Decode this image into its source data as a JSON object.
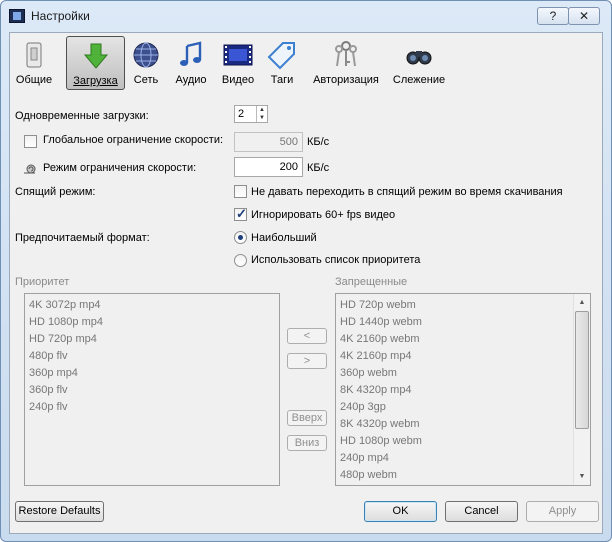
{
  "window": {
    "title": "Настройки",
    "help_label": "?",
    "close_label": "✕"
  },
  "toolbar": {
    "tabs": [
      {
        "label": "Общие",
        "icon": "switch-icon"
      },
      {
        "label": "Загрузка",
        "icon": "download-arrow-icon"
      },
      {
        "label": "Сеть",
        "icon": "globe-icon"
      },
      {
        "label": "Аудио",
        "icon": "music-note-icon"
      },
      {
        "label": "Видео",
        "icon": "film-strip-icon"
      },
      {
        "label": "Таги",
        "icon": "tag-icon"
      },
      {
        "label": "Авторизация",
        "icon": "keys-icon"
      },
      {
        "label": "Слежение",
        "icon": "binoculars-icon"
      }
    ],
    "active": "Загрузка"
  },
  "form": {
    "concurrent_label": "Одновременные загрузки:",
    "concurrent_value": "2",
    "global_limit_label": "Глобальное ограничение скорости:",
    "global_limit_value": "500",
    "global_limit_unit": "КБ/с",
    "global_limit_checked": false,
    "limit_mode_label": "Режим ограничения скорости:",
    "limit_mode_value": "200",
    "limit_mode_unit": "КБ/с",
    "sleep_label": "Спящий режим:",
    "no_sleep_label": "Не давать переходить в спящий режим во время скачивания",
    "no_sleep_checked": false,
    "ignore_60fps_label": "Игнорировать 60+ fps видео",
    "ignore_60fps_checked": true,
    "format_label": "Предпочитаемый формат:",
    "format_options": [
      "Наибольший",
      "Использовать список приоритета"
    ],
    "format_selected": "Наибольший"
  },
  "priority": {
    "title": "Приоритет",
    "items": [
      "4K 3072p mp4",
      "HD 1080p mp4",
      "HD 720p mp4",
      "480p flv",
      "360p mp4",
      "360p flv",
      "240p flv"
    ]
  },
  "forbidden": {
    "title": "Запрещенные",
    "items": [
      "HD 720p webm",
      "HD 1440p webm",
      "4K 2160p webm",
      "4K 2160p mp4",
      "360p webm",
      "8K 4320p mp4",
      "240p 3gp",
      "8K 4320p webm",
      "HD 1080p webm",
      "240p mp4",
      "480p webm"
    ]
  },
  "move_buttons": {
    "left": "<",
    "right": ">",
    "up": "Вверх",
    "down": "Вниз"
  },
  "footer": {
    "restore": "Restore Defaults",
    "ok": "OK",
    "cancel": "Cancel",
    "apply": "Apply"
  }
}
